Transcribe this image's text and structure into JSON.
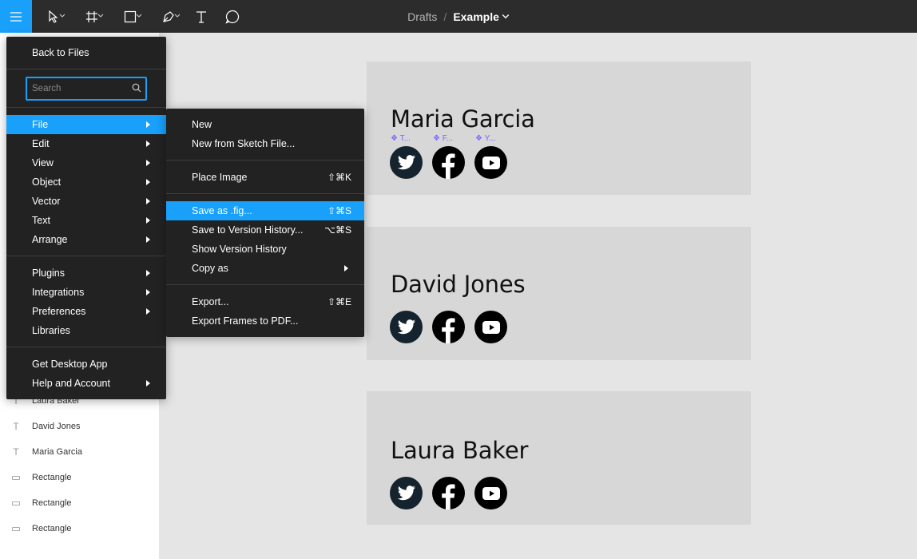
{
  "toolbar": {
    "breadcrumb_drafts": "Drafts",
    "breadcrumb_sep": "/",
    "file_name": "Example",
    "accent_color": "#18a0fb"
  },
  "main_menu": {
    "back": "Back to Files",
    "search_placeholder": "Search",
    "items": [
      {
        "label": "File",
        "submenu": true,
        "active": true
      },
      {
        "label": "Edit",
        "submenu": true
      },
      {
        "label": "View",
        "submenu": true
      },
      {
        "label": "Object",
        "submenu": true
      },
      {
        "label": "Vector",
        "submenu": true
      },
      {
        "label": "Text",
        "submenu": true
      },
      {
        "label": "Arrange",
        "submenu": true
      }
    ],
    "items2": [
      {
        "label": "Plugins",
        "submenu": true
      },
      {
        "label": "Integrations",
        "submenu": true
      },
      {
        "label": "Preferences",
        "submenu": true
      },
      {
        "label": "Libraries",
        "submenu": false
      }
    ],
    "items3": [
      {
        "label": "Get Desktop App",
        "submenu": false
      },
      {
        "label": "Help and Account",
        "submenu": true
      }
    ]
  },
  "file_menu": {
    "new": "New",
    "new_sketch": "New from Sketch File...",
    "place_image": "Place Image",
    "place_image_sc": "⇧⌘K",
    "save_fig": "Save as .fig...",
    "save_fig_sc": "⇧⌘S",
    "save_version": "Save to Version History...",
    "save_version_sc": "⌥⌘S",
    "show_history": "Show Version History",
    "copy_as": "Copy as",
    "export": "Export...",
    "export_sc": "⇧⌘E",
    "export_pdf": "Export Frames to PDF..."
  },
  "layers": [
    {
      "type": "text",
      "name": "Laura Baker"
    },
    {
      "type": "text",
      "name": "David Jones"
    },
    {
      "type": "text",
      "name": "Maria Garcia"
    },
    {
      "type": "rect",
      "name": "Rectangle"
    },
    {
      "type": "rect",
      "name": "Rectangle"
    },
    {
      "type": "rect",
      "name": "Rectangle"
    }
  ],
  "cards": [
    {
      "name": "Maria Garcia"
    },
    {
      "name": "David Jones"
    },
    {
      "name": "Laura Baker"
    }
  ],
  "component_labels": [
    "❖ T...",
    "❖ F...",
    "❖ Y..."
  ]
}
